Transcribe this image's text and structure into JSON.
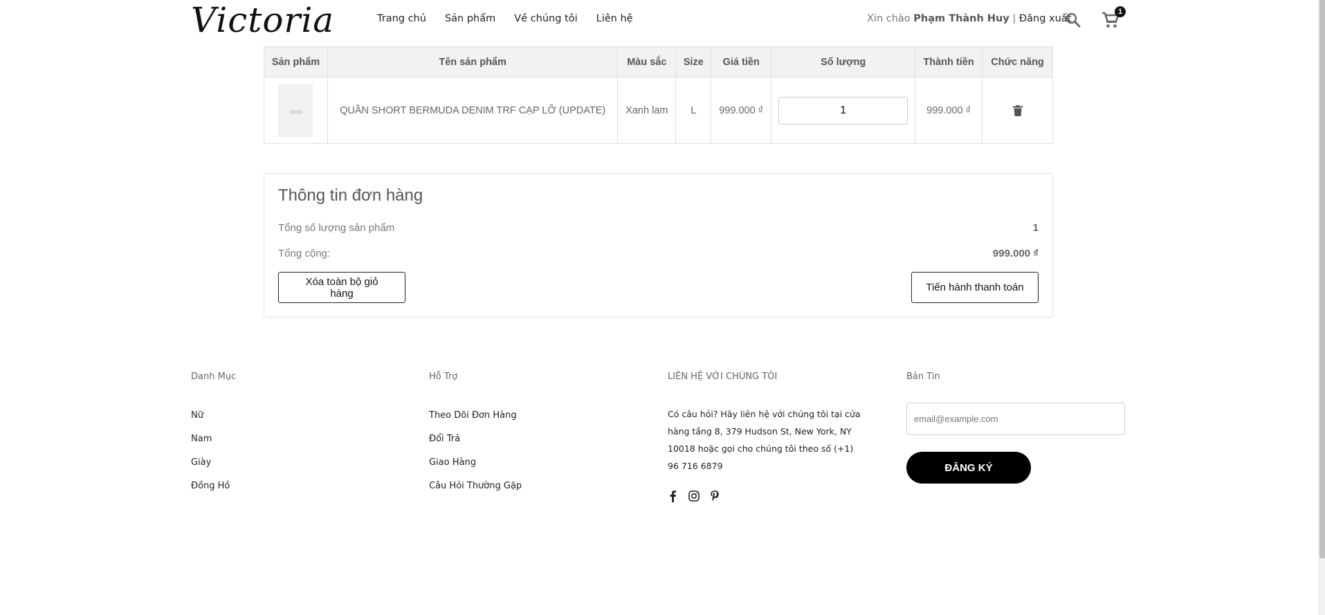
{
  "header": {
    "logo": "Victoria",
    "nav": [
      "Trang chủ",
      "Sản phẩm",
      "Về chúng tôi",
      "Liên hệ"
    ],
    "greeting": "Xin chào",
    "user_name": "Phạm Thành Huy",
    "separator": "|",
    "logout": "Đăng xuất",
    "cart_count": "1"
  },
  "cart": {
    "columns": [
      "Sản phẩm",
      "Tên sản phẩm",
      "Màu sắc",
      "Size",
      "Giá tiền",
      "Số lượng",
      "Thành tiền",
      "Chức năng"
    ],
    "rows": [
      {
        "name": "QUẦN SHORT BERMUDA DENIM TRF CẠP LỠ (UPDATE)",
        "color": "Xanh lam",
        "size": "L",
        "price": "999.000 ₫",
        "quantity": "1",
        "subtotal": "999.000 ₫"
      }
    ]
  },
  "summary": {
    "title": "Thông tin đơn hàng",
    "total_qty_label": "Tổng số lượng sản phẩm",
    "total_qty_value": "1",
    "total_label": "Tổng cộng:",
    "total_value": "999.000 ₫",
    "clear_button": "Xóa toàn bộ giỏ hàng",
    "checkout_button": "Tiến hành thanh toán"
  },
  "footer": {
    "categories": {
      "title": "Danh Mục",
      "items": [
        "Nữ",
        "Nam",
        "Giày",
        "Đồng Hồ"
      ]
    },
    "support": {
      "title": "Hỗ Trợ",
      "items": [
        "Theo Dõi Đơn Hàng",
        "Đổi Trả",
        "Giao Hàng",
        "Câu Hỏi Thường Gặp"
      ]
    },
    "contact": {
      "title": "LIÊN HỆ VỚI CHÚNG TÔI",
      "text": "Có câu hỏi? Hãy liên hệ với chúng tôi tại cửa hàng tầng 8, 379 Hudson St, New York, NY 10018 hoặc gọi cho chúng tôi theo số (+1) 96 716 6879",
      "social": [
        "facebook-icon",
        "instagram-icon",
        "pinterest-icon"
      ]
    },
    "newsletter": {
      "title": "Bản Tin",
      "placeholder": "email@example.com",
      "button": "ĐĂNG KÝ"
    }
  }
}
